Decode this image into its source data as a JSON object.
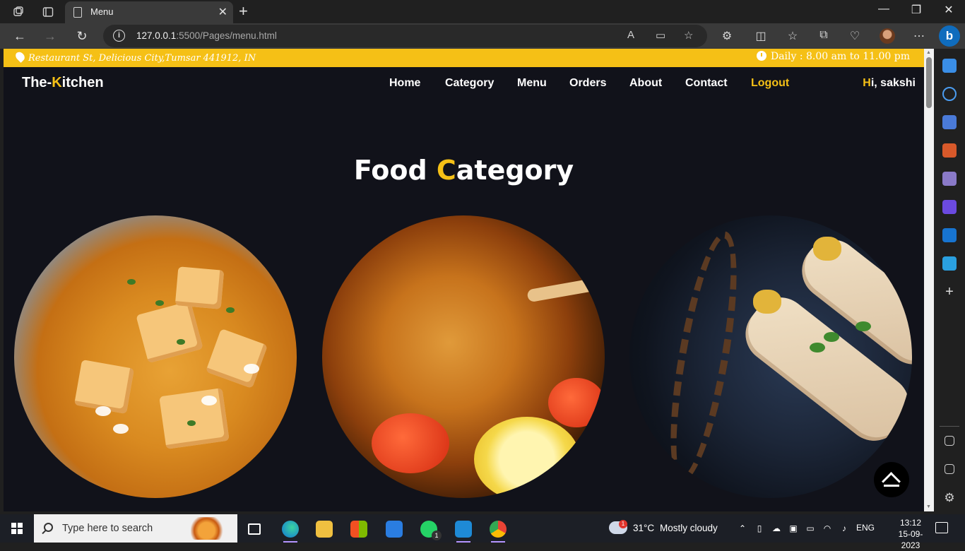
{
  "browser": {
    "tab_title": "Menu",
    "url_host": "127.0.0.1",
    "url_rest": ":5500/Pages/menu.html"
  },
  "topbar": {
    "address": "Restaurant St, Delicious City,Tumsar 441912, IN",
    "hours": "Daily : 8.00 am to 11.00 pm"
  },
  "site": {
    "logo_pre": "The-",
    "logo_k": "K",
    "logo_post": "itchen",
    "nav": [
      "Home",
      "Category",
      "Menu",
      "Orders",
      "About",
      "Contact",
      "Logout"
    ],
    "greet_h": "H",
    "greet_rest": "i, sakshi"
  },
  "section": {
    "title_pre": "Food ",
    "title_c": "C",
    "title_post": "ategory"
  },
  "colors": {
    "accent": "#f5c016",
    "page_bg": "#11121a"
  },
  "taskbar": {
    "search_placeholder": "Type here to search",
    "weather_temp": "31°C",
    "weather_desc": "Mostly cloudy",
    "weather_badge": "1",
    "whatsapp_badge": "1",
    "lang": "ENG",
    "time": "13:12",
    "date": "15-09-2023"
  }
}
